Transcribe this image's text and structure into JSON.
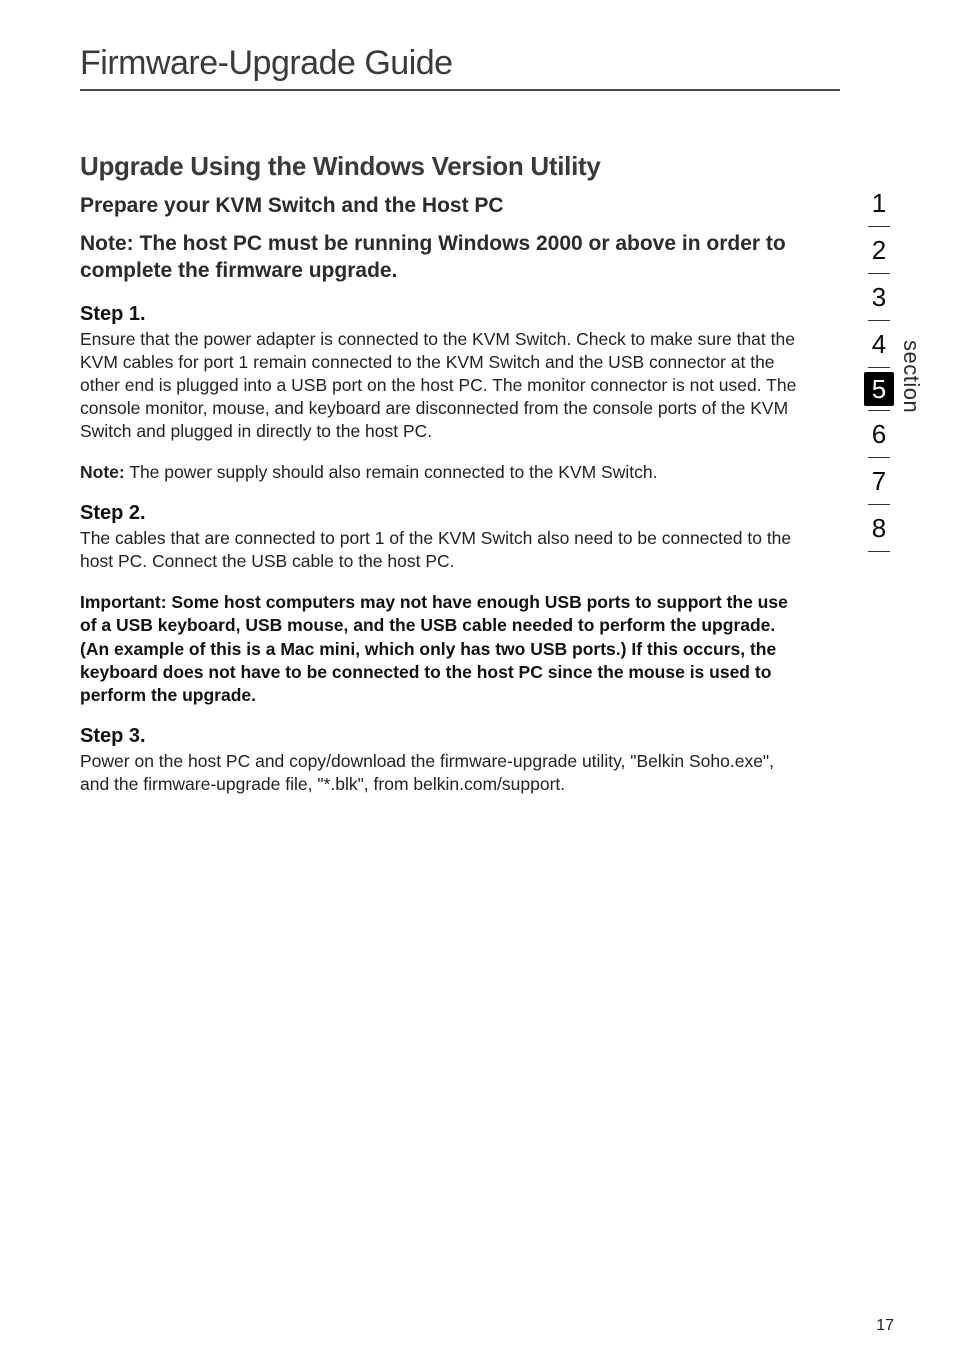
{
  "page": {
    "title": "Firmware-Upgrade Guide",
    "number": "17"
  },
  "headings": {
    "h2_main": "Upgrade Using the Windows Version Utility",
    "h3_prepare": "Prepare your KVM Switch and the Host PC",
    "h3_note": "Note: The host PC must be running Windows 2000 or above in order to complete the firmware upgrade."
  },
  "steps": {
    "s1_head": "Step 1.",
    "s1_body": "Ensure that the power adapter is connected to the KVM Switch. Check to make sure that the KVM cables for port 1 remain connected to the KVM Switch and the USB connector at the other end is plugged into a USB port on the host PC. The monitor connector is not used. The console monitor, mouse, and keyboard are disconnected from the console ports of the KVM Switch and plugged in directly to the host PC.",
    "note_bold": "Note:",
    "note_text": " The power supply should also remain connected to the KVM Switch.",
    "s2_head": "Step 2.",
    "s2_body": "The cables that are connected to port 1 of the KVM Switch also need to be connected to the host PC. Connect the USB cable to the host PC.",
    "important": "Important: Some host computers may not have enough USB ports to support the use of a USB keyboard, USB mouse, and the USB cable needed to perform the upgrade. (An example of this is a Mac mini, which only has two USB ports.) If this occurs, the keyboard does not have to be connected to the host PC since the mouse is used to perform the upgrade.",
    "s3_head": "Step 3.",
    "s3_body": "Power on the host PC and copy/download the firmware-upgrade utility, \"Belkin Soho.exe\", and the firmware-upgrade file, \"*.blk\", from belkin.com/support."
  },
  "sidebar": {
    "items": [
      "1",
      "2",
      "3",
      "4",
      "5",
      "6",
      "7",
      "8"
    ],
    "active_index": 4,
    "label": "section"
  }
}
